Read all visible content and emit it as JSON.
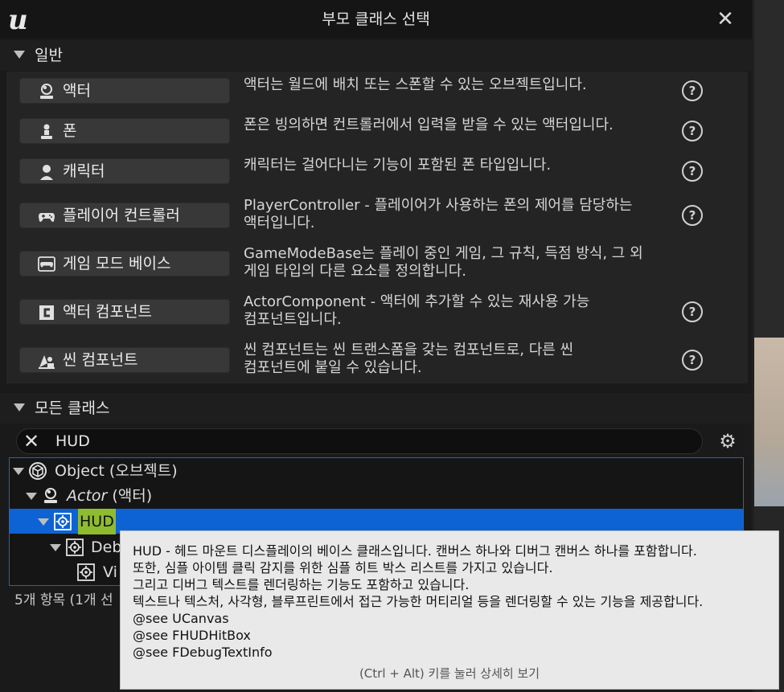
{
  "dialog": {
    "title": "부모 클래스 선택",
    "close_icon": "close-icon"
  },
  "general": {
    "header": "일반",
    "items": [
      {
        "label": "액터",
        "icon": "actor-icon",
        "description": [
          "액터는 월드에 배치 또는 스폰할 수 있는 오브젝트입니다."
        ]
      },
      {
        "label": "폰",
        "icon": "pawn-icon",
        "description": [
          "폰은 빙의하면 컨트롤러에서 입력을 받을 수 있는 액터입니다."
        ]
      },
      {
        "label": "캐릭터",
        "icon": "character-icon",
        "description": [
          "캐릭터는 걸어다니는 기능이 포함된 폰 타입입니다."
        ]
      },
      {
        "label": "플레이어 컨트롤러",
        "icon": "gamepad-icon",
        "description": [
          "PlayerController - 플레이어가 사용하는 폰의 제어를 담당하는",
          "액터입니다."
        ]
      },
      {
        "label": "게임 모드 베이스",
        "icon": "game-mode-icon",
        "description": [
          "GameModeBase는 플레이 중인 게임, 그 규칙, 득점 방식, 그 외",
          "게임 타입의 다른 요소를 정의합니다."
        ]
      },
      {
        "label": "액터 컴포넌트",
        "icon": "actor-component-icon",
        "description": [
          "ActorComponent - 액터에 추가할 수 있는 재사용 가능",
          "컴포넌트입니다."
        ]
      },
      {
        "label": "씬 컴포넌트",
        "icon": "scene-component-icon",
        "description": [
          "씬 컴포넌트는 씬 트랜스폼을 갖는 컴포넌트로, 다른 씬",
          "컴포넌트에 붙일 수 있습니다."
        ]
      }
    ]
  },
  "all_classes": {
    "header": "모든 클래스",
    "search_value": "HUD",
    "tree": {
      "object": {
        "name": "Object",
        "suffix": " (오브젝트)"
      },
      "actor": {
        "name": "Actor",
        "suffix": " (액터)"
      },
      "hud": {
        "name": "HUD"
      },
      "debug": {
        "name": "Deb"
      },
      "vis": {
        "name": "Vi"
      }
    },
    "status": "5개 항목 (1개 선"
  },
  "tooltip": {
    "lines": [
      "HUD - 헤드 마운트 디스플레이의 베이스 클래스입니다. 캔버스 하나와 디버그 캔버스 하나를 포함합니다.",
      "또한, 심플 아이템 클릭 감지를 위한 심플 히트 박스 리스트를 가지고 있습니다.",
      "그리고 디버그 텍스트를 렌더링하는 기능도 포함하고 있습니다.",
      "텍스트나 텍스처, 사각형, 블루프린트에서 접근 가능한 머티리얼 등을 렌더링할 수 있는 기능을 제공합니다.",
      "@see UCanvas",
      "@see FHUDHitBox",
      "@see FDebugTextInfo"
    ],
    "footer": "(Ctrl + Alt) 키를 눌러 상세히 보기"
  }
}
